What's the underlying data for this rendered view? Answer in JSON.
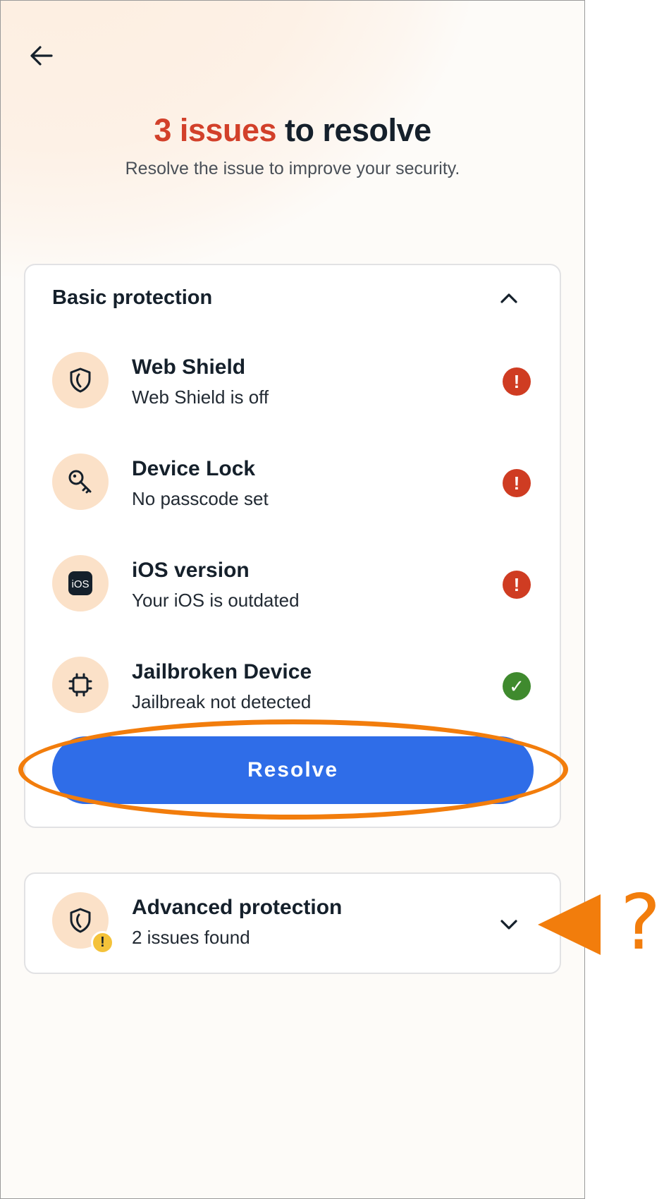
{
  "header": {
    "back_icon": "arrow-left-icon",
    "title_count": "3 issues",
    "title_rest": " to resolve",
    "subtitle": "Resolve the issue to improve your security."
  },
  "basic": {
    "title": "Basic protection",
    "chevron_icon": "chevron-up-icon",
    "items": [
      {
        "title": "Web Shield",
        "subtitle": "Web Shield is off",
        "icon": "shield-icon",
        "status": "error-icon",
        "status_glyph": "!"
      },
      {
        "title": "Device Lock",
        "subtitle": "No passcode set",
        "icon": "key-icon",
        "status": "error-icon",
        "status_glyph": "!"
      },
      {
        "title": "iOS version",
        "subtitle": "Your iOS is outdated",
        "icon": "ios-icon",
        "icon_text": "iOS",
        "status": "error-icon",
        "status_glyph": "!"
      },
      {
        "title": "Jailbroken Device",
        "subtitle": "Jailbreak not detected",
        "icon": "chip-icon",
        "status": "check-icon",
        "status_glyph": "✓"
      }
    ],
    "resolve_label": "Resolve"
  },
  "advanced": {
    "title": "Advanced protection",
    "subtitle": "2 issues found",
    "icon": "shield-icon",
    "badge_icon": "warning-badge-icon",
    "badge_glyph": "!",
    "chevron_icon": "chevron-down-icon"
  },
  "annotation": {
    "question_mark": "?",
    "color": "#f27d0c"
  },
  "colors": {
    "accent_red": "#d2402a",
    "error": "#cf3c22",
    "ok": "#3f8a2e",
    "button_blue": "#2f6de8",
    "icon_bg": "#fbe1c8",
    "warning": "#f4c23a"
  }
}
